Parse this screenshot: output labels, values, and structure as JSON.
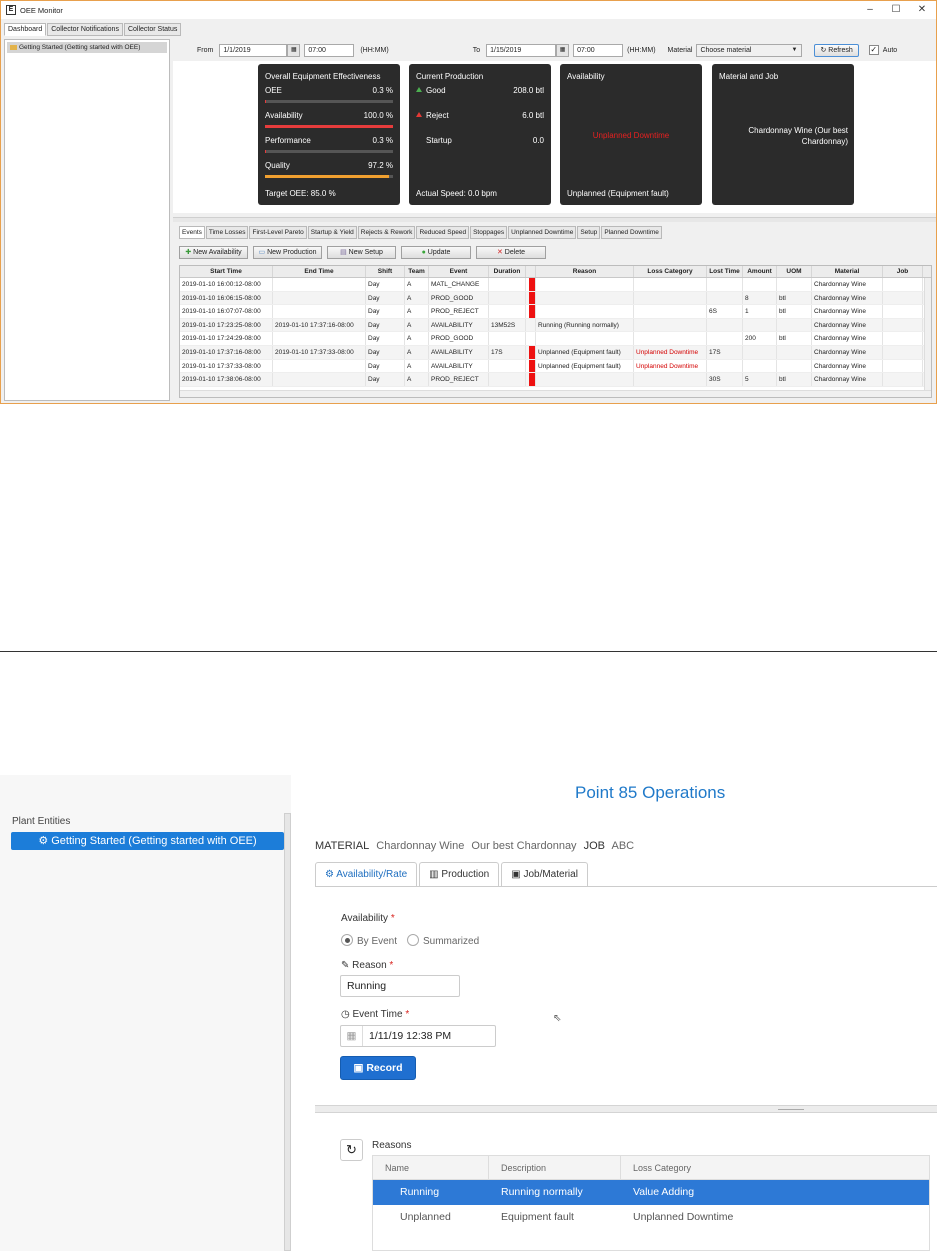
{
  "win1": {
    "title": "OEE Monitor",
    "controls": [
      "–",
      "☐",
      "✕"
    ],
    "tabs": [
      "Dashboard",
      "Collector Notifications",
      "Collector Status"
    ],
    "tree_item": "Getting Started (Getting started with OEE)",
    "toolbar": {
      "from_label": "From",
      "from_date": "1/1/2019",
      "from_time": "07:00",
      "from_fmt": "(HH:MM)",
      "to_label": "To",
      "to_date": "1/15/2019",
      "to_time": "07:00",
      "to_fmt": "(HH:MM)",
      "material_label": "Material",
      "material_value": "Choose material",
      "refresh_label": "Refresh",
      "auto_label": "Auto"
    },
    "oee_card": {
      "title": "Overall Equipment Effectiveness",
      "oee_label": "OEE",
      "oee_value": "0.3 %",
      "oee_fraction": 0.003,
      "availability_label": "Availability",
      "availability_value": "100.0 %",
      "availability_fraction": 1.0,
      "performance_label": "Performance",
      "performance_value": "0.3 %",
      "performance_fraction": 0.003,
      "quality_label": "Quality",
      "quality_value": "97.2 %",
      "quality_fraction": 0.972,
      "target": "Target OEE: 85.0 %",
      "colors": {
        "availability": "#e63c3c",
        "quality": "#f0a030",
        "good": "#4caf50",
        "reject": "#e53935"
      }
    },
    "prod_card": {
      "title": "Current Production",
      "good_label": "Good",
      "good_value": "208.0 btl",
      "reject_label": "Reject",
      "reject_value": "6.0 btl",
      "startup_label": "Startup",
      "startup_value": "0.0",
      "speed": "Actual Speed: 0.0  bpm"
    },
    "avail_card": {
      "title": "Availability",
      "status": "Unplanned Downtime",
      "status_color": "#e62020",
      "reason": "Unplanned (Equipment fault)"
    },
    "job_card": {
      "title": "Material and Job",
      "material": "Chardonnay Wine (Our best Chardonnay)"
    },
    "event_tabs": [
      "Events",
      "Time Losses",
      "First-Level Pareto",
      "Startup & Yield",
      "Rejects & Rework",
      "Reduced Speed",
      "Stoppages",
      "Unplanned Downtime",
      "Setup",
      "Planned Downtime"
    ],
    "event_buttons": [
      "New Availability",
      "New Production",
      "New Setup",
      "Update",
      "Delete"
    ],
    "grid_columns": [
      "Start Time",
      "End Time",
      "Shift",
      "Team",
      "Event",
      "Duration",
      "",
      "Reason",
      "Loss Category",
      "Lost Time",
      "Amount",
      "UOM",
      "Material",
      "Job"
    ],
    "grid_rows": [
      {
        "start": "2019-01-10 16:00:12-08:00",
        "end": "",
        "shift": "Day",
        "team": "A",
        "event": "MATL_CHANGE",
        "duration": "",
        "red": true,
        "reason": "",
        "loss": "",
        "lost": "",
        "amount": "",
        "uom": "",
        "material": "Chardonnay Wine",
        "job": ""
      },
      {
        "start": "2019-01-10 16:06:15-08:00",
        "end": "",
        "shift": "Day",
        "team": "A",
        "event": "PROD_GOOD",
        "duration": "",
        "red": true,
        "reason": "",
        "loss": "",
        "lost": "",
        "amount": "8",
        "uom": "btl",
        "material": "Chardonnay Wine",
        "job": ""
      },
      {
        "start": "2019-01-10 16:07:07-08:00",
        "end": "",
        "shift": "Day",
        "team": "A",
        "event": "PROD_REJECT",
        "duration": "",
        "red": true,
        "reason": "",
        "loss": "",
        "lost": "6S",
        "amount": "1",
        "uom": "btl",
        "material": "Chardonnay Wine",
        "job": ""
      },
      {
        "start": "2019-01-10 17:23:25-08:00",
        "end": "2019-01-10 17:37:16-08:00",
        "shift": "Day",
        "team": "A",
        "event": "AVAILABILITY",
        "duration": "13M52S",
        "red": false,
        "reason": "Running (Running normally)",
        "loss": "",
        "lost": "",
        "amount": "",
        "uom": "",
        "material": "Chardonnay Wine",
        "job": ""
      },
      {
        "start": "2019-01-10 17:24:29-08:00",
        "end": "",
        "shift": "Day",
        "team": "A",
        "event": "PROD_GOOD",
        "duration": "",
        "red": false,
        "reason": "",
        "loss": "",
        "lost": "",
        "amount": "200",
        "uom": "btl",
        "material": "Chardonnay Wine",
        "job": ""
      },
      {
        "start": "2019-01-10 17:37:16-08:00",
        "end": "2019-01-10 17:37:33-08:00",
        "shift": "Day",
        "team": "A",
        "event": "AVAILABILITY",
        "duration": "17S",
        "red": true,
        "reason": "Unplanned (Equipment fault)",
        "loss": "Unplanned Downtime",
        "lost": "17S",
        "amount": "",
        "uom": "",
        "material": "Chardonnay Wine",
        "job": ""
      },
      {
        "start": "2019-01-10 17:37:33-08:00",
        "end": "",
        "shift": "Day",
        "team": "A",
        "event": "AVAILABILITY",
        "duration": "",
        "red": true,
        "reason": "Unplanned (Equipment fault)",
        "loss": "Unplanned Downtime",
        "lost": "",
        "amount": "",
        "uom": "",
        "material": "Chardonnay Wine",
        "job": ""
      },
      {
        "start": "2019-01-10 17:38:06-08:00",
        "end": "",
        "shift": "Day",
        "team": "A",
        "event": "PROD_REJECT",
        "duration": "",
        "red": true,
        "reason": "",
        "loss": "",
        "lost": "30S",
        "amount": "5",
        "uom": "btl",
        "material": "Chardonnay Wine",
        "job": ""
      }
    ]
  },
  "win2": {
    "plant_label": "Plant Entities",
    "plant_item": "Getting Started (Getting started with OEE)",
    "title": "Point 85 Operations",
    "material_label": "MATERIAL",
    "material_name": "Chardonnay Wine",
    "material_desc": "Our best Chardonnay",
    "job_label": "JOB",
    "job_value": "ABC",
    "tabs": [
      "Availability/Rate",
      "Production",
      "Job/Material"
    ],
    "availability_label": "Availability",
    "by_event": "By Event",
    "summarized": "Summarized",
    "reason_label": "Reason",
    "reason_value": "Running",
    "event_time_label": "Event Time",
    "event_time_value": "1/11/19 12:38 PM",
    "record_label": "Record",
    "reasons_label": "Reasons",
    "reasons_columns": [
      "Name",
      "Description",
      "Loss Category"
    ],
    "reasons_rows": [
      {
        "name": "Running",
        "desc": "Running normally",
        "loss": "Value Adding"
      },
      {
        "name": "Unplanned",
        "desc": "Equipment fault",
        "loss": "Unplanned Downtime"
      }
    ]
  }
}
